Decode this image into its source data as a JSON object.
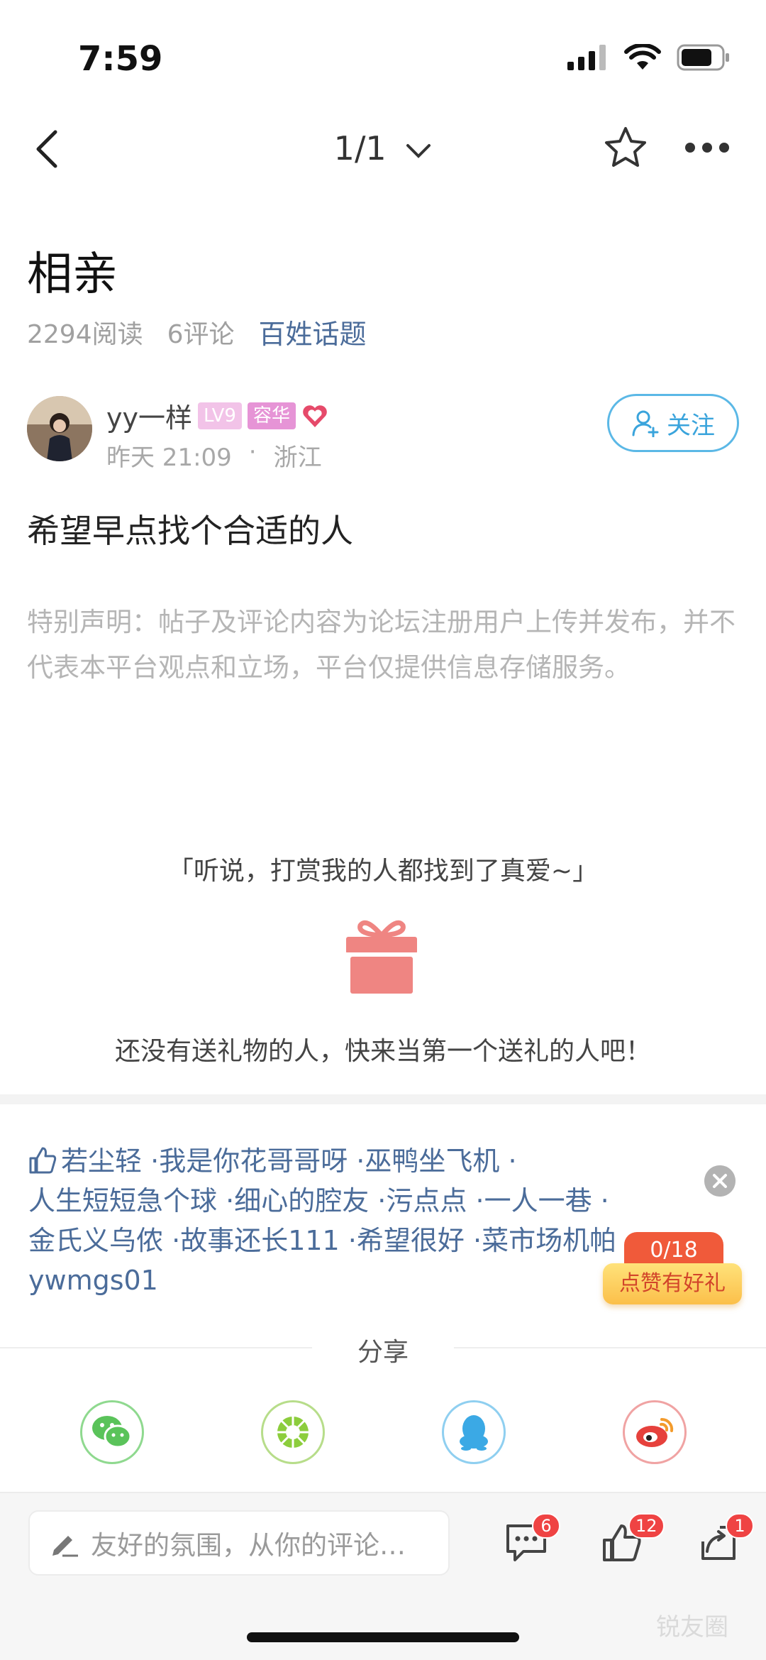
{
  "status_bar": {
    "time": "7:59"
  },
  "nav": {
    "pager": "1/1"
  },
  "post": {
    "title": "相亲",
    "reads": "2294阅读",
    "comments": "6评论",
    "topic": "百姓话题",
    "body": "希望早点找个合适的人",
    "disclaimer": "特别声明：帖子及评论内容为论坛注册用户上传并发布，并不代表本平台观点和立场，平台仅提供信息存储服务。"
  },
  "author": {
    "name": "yy一样",
    "level_badge": "LV9",
    "title_badge": "容华",
    "time": "昨天 21:09",
    "dot": "·",
    "location": "浙江",
    "follow_label": "关注"
  },
  "reward": {
    "slogan": "「听说，打赏我的人都找到了真爱~」",
    "empty_text": "还没有送礼物的人，快来当第一个送礼的人吧！"
  },
  "likes": {
    "names": [
      "若尘轻",
      "我是你花哥哥呀",
      "巫鸭坐飞机",
      "人生短短急个球",
      "细心的腔友",
      "污点点",
      "一人一巷",
      "金氏义乌侬",
      "故事还长111",
      "希望很好",
      "菜市场机帕",
      "ywmgs01"
    ],
    "separator": " ·"
  },
  "promo": {
    "count": "0/18",
    "label": "点赞有好礼"
  },
  "share": {
    "title": "分享",
    "targets": [
      "wechat-icon",
      "moments-icon",
      "qq-icon",
      "weibo-icon"
    ]
  },
  "bottom_bar": {
    "comment_placeholder": "友好的氛围，从你的评论…",
    "comment_count": "6",
    "like_count": "12",
    "share_count": "1"
  },
  "watermark": "锐友圈",
  "colors": {
    "accent_blue": "#4b6c9a",
    "follow_blue": "#3aa4dc",
    "badge_red": "#ef4343",
    "gift_red": "#ef8582"
  }
}
